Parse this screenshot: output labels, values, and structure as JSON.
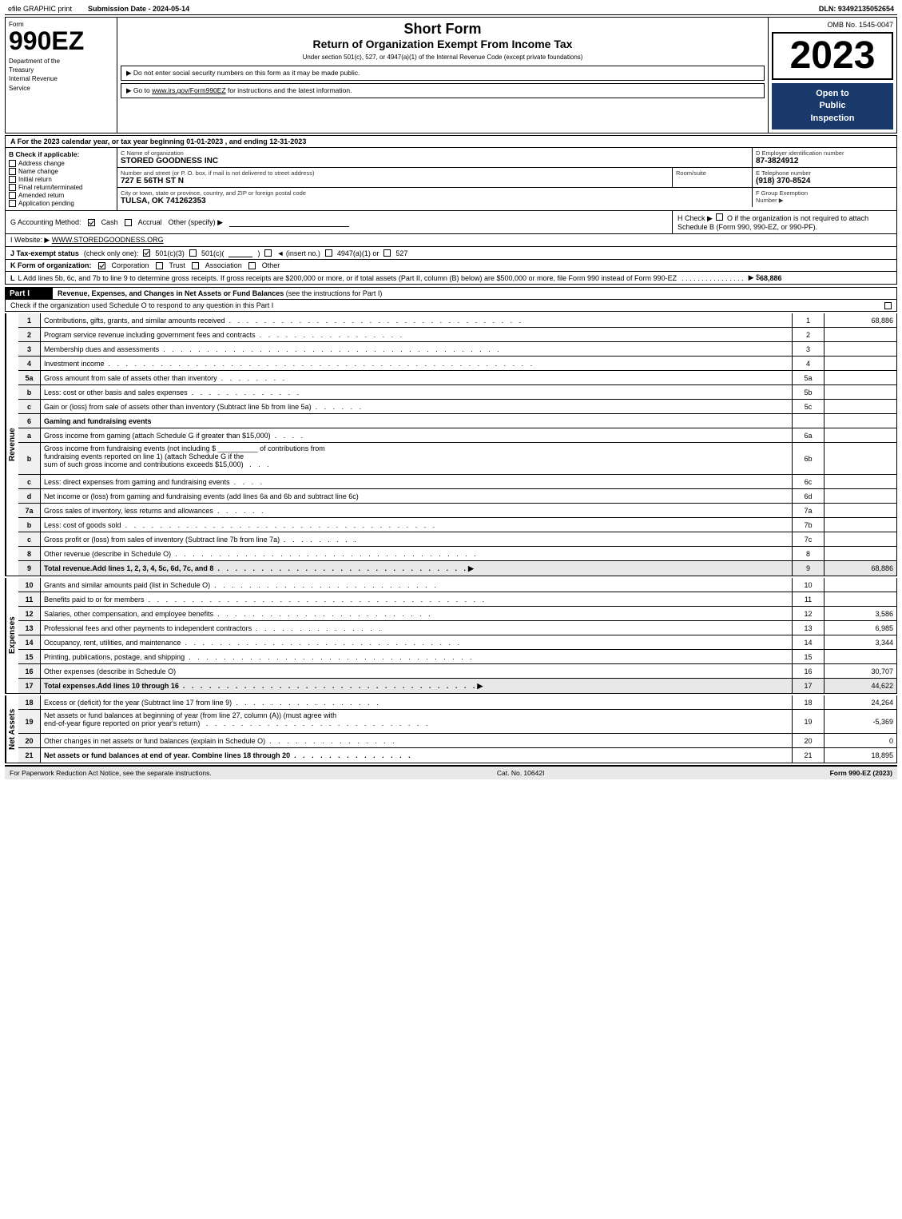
{
  "topBar": {
    "efile": "efile GRAPHIC print",
    "submission": "Submission Date - 2024-05-14",
    "dln": "DLN: 93492135052654"
  },
  "header": {
    "formLabel": "Form",
    "formNumber": "990EZ",
    "deptLine1": "Department of the",
    "deptLine2": "Treasury",
    "deptLine3": "Internal Revenue",
    "deptLine4": "Service",
    "shortForm": "Short Form",
    "returnTitle": "Return of Organization Exempt From Income Tax",
    "subtitle": "Under section 501(c), 527, or 4947(a)(1) of the Internal Revenue Code (except private foundations)",
    "instruction1": "▶ Do not enter social security numbers on this form as it may be made public.",
    "instruction2": "▶ Go to www.irs.gov/Form990EZ for instructions and the latest information.",
    "ombNo": "OMB No. 1545-0047",
    "year": "2023",
    "openPublic": "Open to\nPublic\nInspection"
  },
  "sectionA": {
    "label": "A For the 2023 calendar year, or tax year beginning 01-01-2023 , and ending 12-31-2023"
  },
  "sectionB": {
    "label": "B Check if applicable:",
    "items": [
      {
        "id": "address-change",
        "label": "Address change",
        "checked": false
      },
      {
        "id": "name-change",
        "label": "Name change",
        "checked": false
      },
      {
        "id": "initial-return",
        "label": "Initial return",
        "checked": false
      },
      {
        "id": "final-return",
        "label": "Final return/terminated",
        "checked": false
      },
      {
        "id": "amended-return",
        "label": "Amended return",
        "checked": false
      },
      {
        "id": "application-pending",
        "label": "Application pending",
        "checked": false
      }
    ]
  },
  "orgInfo": {
    "nameLabel": "C Name of organization",
    "name": "STORED GOODNESS INC",
    "addressLabel": "Number and street (or P. O. box, if mail is not delivered to street address)",
    "address": "727 E 56TH ST N",
    "roomLabel": "Room/suite",
    "room": "",
    "cityLabel": "City or town, state or province, country, and ZIP or foreign postal code",
    "city": "TULSA, OK  741262353"
  },
  "einBlock": {
    "dLabel": "D Employer identification number",
    "ein": "87-3824912",
    "eLabel": "E Telephone number",
    "phone": "(918) 370-8524",
    "fLabel": "F Group Exemption",
    "fLabel2": "Number ▶",
    "fValue": ""
  },
  "accounting": {
    "gLabel": "G Accounting Method:",
    "cashLabel": "Cash",
    "cashChecked": true,
    "accrualLabel": "Accrual",
    "accrualChecked": false,
    "otherLabel": "Other (specify) ▶",
    "hLabel": "H Check ▶",
    "hText": "O if the organization is not required to attach Schedule B (Form 990, 990-EZ, or 990-PF)."
  },
  "website": {
    "iLabel": "I Website: ▶",
    "url": "WWW.STOREDGOODNESS.ORG"
  },
  "taxStatus": {
    "jLabel": "J Tax-exempt status",
    "jNote": "(check only one):",
    "status501c3": "501(c)(3)",
    "status501c3Checked": true,
    "status501c": "501(c)(",
    "statusInsert": "insert no.",
    "status4947": "4947(a)(1) or",
    "status527": "527"
  },
  "formK": {
    "kLabel": "K Form of organization:",
    "corporation": "Corporation",
    "corporationChecked": true,
    "trust": "Trust",
    "trustChecked": false,
    "association": "Association",
    "assocChecked": false,
    "other": "Other"
  },
  "lineL": {
    "text": "L Add lines 5b, 6c, and 7b to line 9 to determine gross receipts. If gross receipts are $200,000 or more, or if total assets (Part II, column (B) below) are $500,000 or more, file Form 990 instead of Form 990-EZ",
    "arrow": "▶ $",
    "value": "68,886"
  },
  "partI": {
    "header": "Part I",
    "title": "Revenue, Expenses, and Changes in Net Assets or Fund Balances",
    "titleNote": "(see the instructions for Part I)",
    "checkNote": "Check if the organization used Schedule O to respond to any question in this Part I",
    "lines": [
      {
        "num": "1",
        "desc": "Contributions, gifts, grants, and similar amounts received",
        "dots": true,
        "ref": "",
        "value": "68,886"
      },
      {
        "num": "2",
        "desc": "Program service revenue including government fees and contracts",
        "dots": true,
        "ref": "",
        "value": ""
      },
      {
        "num": "3",
        "desc": "Membership dues and assessments",
        "dots": true,
        "ref": "",
        "value": ""
      },
      {
        "num": "4",
        "desc": "Investment income",
        "dots": true,
        "ref": "",
        "value": ""
      },
      {
        "num": "5a",
        "desc": "Gross amount from sale of assets other than inventory",
        "dots": false,
        "ref": "5a",
        "value": ""
      },
      {
        "num": "b",
        "desc": "Less: cost or other basis and sales expenses",
        "dots": false,
        "ref": "5b",
        "value": ""
      },
      {
        "num": "c",
        "desc": "Gain or (loss) from sale of assets other than inventory (Subtract line 5b from line 5a)",
        "dots": true,
        "ref": "5c",
        "value": ""
      },
      {
        "num": "6",
        "desc": "Gaming and fundraising events",
        "dots": false,
        "ref": "",
        "value": ""
      },
      {
        "num": "a",
        "desc": "Gross income from gaming (attach Schedule G if greater than $15,000)",
        "dots": false,
        "ref": "6a",
        "value": ""
      },
      {
        "num": "b",
        "desc": "Gross income from fundraising events (not including $ __________ of contributions from fundraising events reported on line 1) (attach Schedule G if the sum of such gross income and contributions exceeds $15,000)",
        "dots": false,
        "ref": "6b",
        "value": ""
      },
      {
        "num": "c",
        "desc": "Less: direct expenses from gaming and fundraising events",
        "dots": false,
        "ref": "6c",
        "value": ""
      },
      {
        "num": "d",
        "desc": "Net income or (loss) from gaming and fundraising events (add lines 6a and 6b and subtract line 6c)",
        "dots": false,
        "ref": "6d",
        "value": ""
      },
      {
        "num": "7a",
        "desc": "Gross sales of inventory, less returns and allowances",
        "dots": false,
        "ref": "7a",
        "value": ""
      },
      {
        "num": "b",
        "desc": "Less: cost of goods sold",
        "dots": false,
        "ref": "7b",
        "value": ""
      },
      {
        "num": "c",
        "desc": "Gross profit or (loss) from sales of inventory (Subtract line 7b from line 7a)",
        "dots": true,
        "ref": "7c",
        "value": ""
      },
      {
        "num": "8",
        "desc": "Other revenue (describe in Schedule O)",
        "dots": true,
        "ref": "",
        "value": ""
      },
      {
        "num": "9",
        "desc": "Total revenue. Add lines 1, 2, 3, 4, 5c, 6d, 7c, and 8",
        "dots": true,
        "bold": true,
        "arrow": true,
        "ref": "9",
        "value": "68,886"
      }
    ]
  },
  "expenses": {
    "lines": [
      {
        "num": "10",
        "desc": "Grants and similar amounts paid (list in Schedule O)",
        "dots": true,
        "ref": "10",
        "value": ""
      },
      {
        "num": "11",
        "desc": "Benefits paid to or for members",
        "dots": true,
        "ref": "11",
        "value": ""
      },
      {
        "num": "12",
        "desc": "Salaries, other compensation, and employee benefits",
        "dots": true,
        "ref": "12",
        "value": "3,586"
      },
      {
        "num": "13",
        "desc": "Professional fees and other payments to independent contractors",
        "dots": true,
        "ref": "13",
        "value": "6,985"
      },
      {
        "num": "14",
        "desc": "Occupancy, rent, utilities, and maintenance",
        "dots": true,
        "ref": "14",
        "value": "3,344"
      },
      {
        "num": "15",
        "desc": "Printing, publications, postage, and shipping",
        "dots": true,
        "ref": "15",
        "value": ""
      },
      {
        "num": "16",
        "desc": "Other expenses (describe in Schedule O)",
        "dots": false,
        "ref": "16",
        "value": "30,707"
      },
      {
        "num": "17",
        "desc": "Total expenses. Add lines 10 through 16",
        "dots": true,
        "bold": true,
        "arrow": true,
        "ref": "17",
        "value": "44,622"
      }
    ]
  },
  "netAssets": {
    "lines": [
      {
        "num": "18",
        "desc": "Excess or (deficit) for the year (Subtract line 17 from line 9)",
        "dots": true,
        "ref": "18",
        "value": "24,264"
      },
      {
        "num": "19",
        "desc": "Net assets or fund balances at beginning of year (from line 27, column (A)) (must agree with end-of-year figure reported on prior year's return)",
        "dots": true,
        "ref": "19",
        "value": "-5,369"
      },
      {
        "num": "20",
        "desc": "Other changes in net assets or fund balances (explain in Schedule O)",
        "dots": true,
        "ref": "20",
        "value": "0"
      },
      {
        "num": "21",
        "desc": "Net assets or fund balances at end of year. Combine lines 18 through 20",
        "dots": true,
        "ref": "21",
        "value": "18,895"
      }
    ]
  },
  "footer": {
    "left": "For Paperwork Reduction Act Notice, see the separate instructions.",
    "middle": "Cat. No. 10642I",
    "right": "Form 990-EZ (2023)"
  }
}
